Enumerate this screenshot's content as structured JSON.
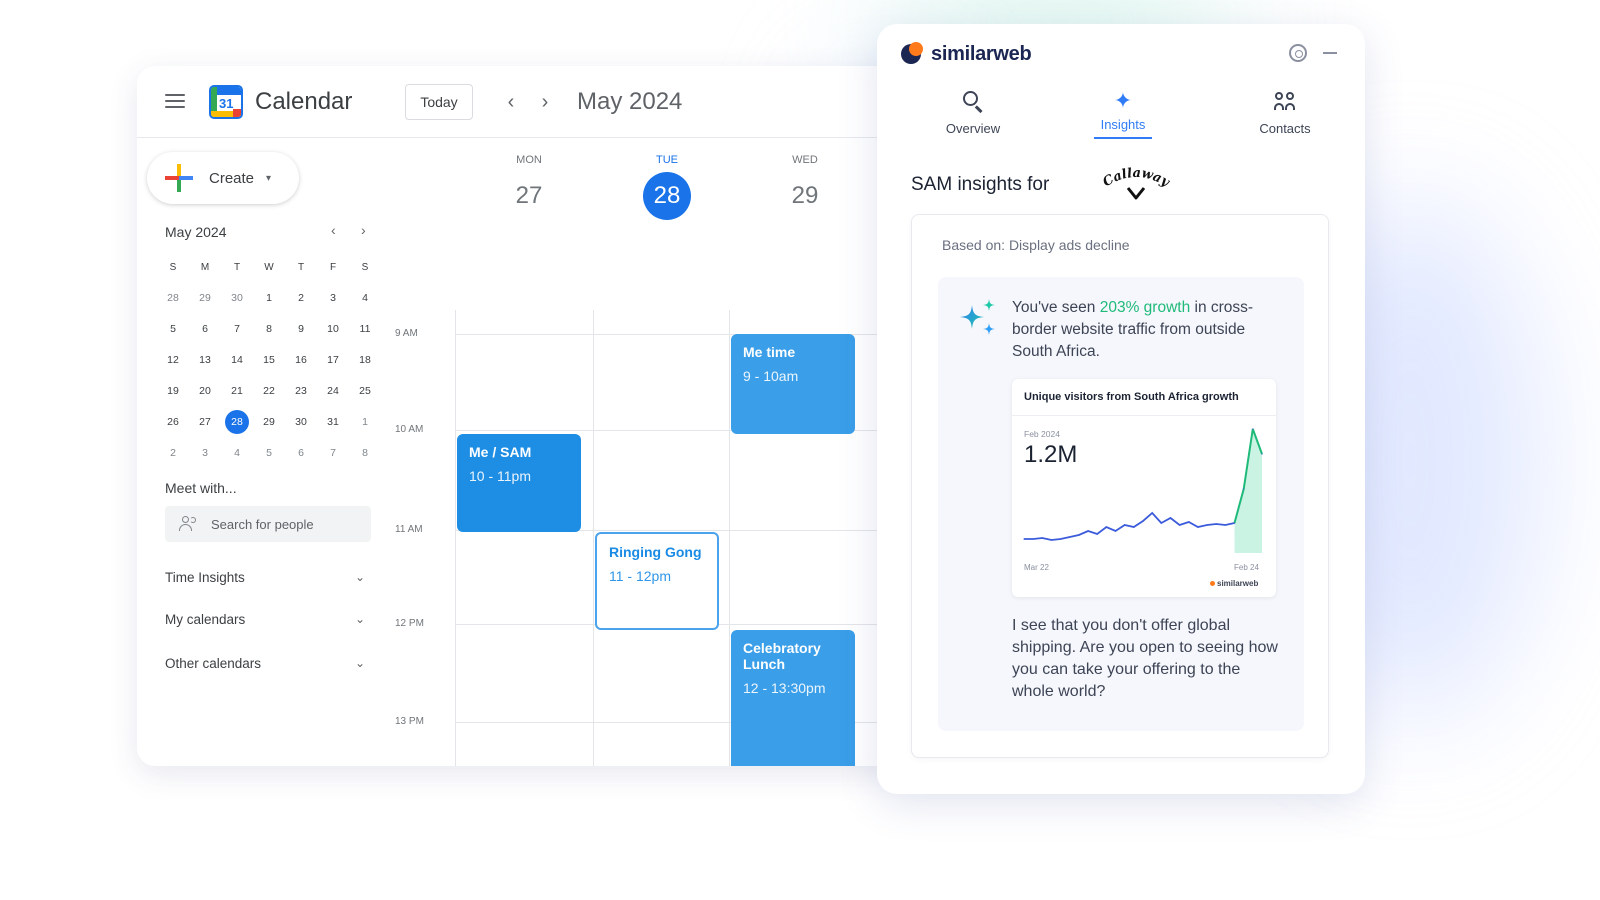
{
  "calendar": {
    "app_title": "Calendar",
    "logo_number": "31",
    "today_label": "Today",
    "prev_symbol": "‹",
    "next_symbol": "›",
    "month_label": "May 2024",
    "create_label": "Create",
    "create_caret": "▾",
    "mini": {
      "title": "May 2024",
      "prev_symbol": "‹",
      "next_symbol": "›",
      "weekdays": [
        "S",
        "M",
        "T",
        "W",
        "T",
        "F",
        "S"
      ],
      "weeks": [
        [
          "28",
          "29",
          "30",
          "1",
          "2",
          "3",
          "4"
        ],
        [
          "5",
          "6",
          "7",
          "8",
          "9",
          "10",
          "11"
        ],
        [
          "12",
          "13",
          "14",
          "15",
          "16",
          "17",
          "18"
        ],
        [
          "19",
          "20",
          "21",
          "22",
          "23",
          "24",
          "25"
        ],
        [
          "26",
          "27",
          "28",
          "29",
          "30",
          "31",
          "1"
        ],
        [
          "2",
          "3",
          "4",
          "5",
          "6",
          "7",
          "8"
        ]
      ],
      "selected": "28"
    },
    "meet_with_label": "Meet with...",
    "people_search_placeholder": "Search for people",
    "sections": [
      {
        "label": "Time Insights",
        "chevron": "⌄"
      },
      {
        "label": "My calendars",
        "chevron": "⌄"
      },
      {
        "label": "Other calendars",
        "chevron": "⌄"
      }
    ],
    "days": [
      {
        "dow": "MON",
        "num": "27",
        "today": false
      },
      {
        "dow": "TUE",
        "num": "28",
        "today": true
      },
      {
        "dow": "WED",
        "num": "29",
        "today": false
      }
    ],
    "hours": [
      "9 AM",
      "10 AM",
      "11 AM",
      "12 PM",
      "13 PM"
    ],
    "events": [
      {
        "title": "Me time",
        "time": "9 - 10am",
        "style": "solid"
      },
      {
        "title": "Me / SAM",
        "time": "10 - 11pm",
        "style": "solid-dark"
      },
      {
        "title": "Ringing Gong",
        "time": "11 - 12pm",
        "style": "outline"
      },
      {
        "title": "Celebratory Lunch",
        "time": "12 - 13:30pm",
        "style": "solid"
      }
    ]
  },
  "similarweb": {
    "brand": "similarweb",
    "tabs": [
      {
        "label": "Overview",
        "icon": "search-icon",
        "active": false
      },
      {
        "label": "Insights",
        "icon": "sparkle-icon",
        "active": true
      },
      {
        "label": "Contacts",
        "icon": "contacts-icon",
        "active": false
      }
    ],
    "sam_title": "SAM insights for",
    "company_logo_text": "Callaway",
    "based_on": "Based on: Display ads decline",
    "insight_pre": "You've seen ",
    "insight_highlight": "203% growth",
    "insight_post": " in cross-border website traffic from outside South Africa.",
    "colors": {
      "accent": "#2f7cf6",
      "highlight": "#1fba7a",
      "brand_dark": "#1b2653",
      "brand_orange": "#ff7a1a"
    },
    "chart": {
      "title": "Unique visitors from South Africa growth",
      "date_label": "Feb 2024",
      "value_label": "1.2M",
      "x_start": "Mar 22",
      "x_end": "Feb 24",
      "watermark": "similarweb"
    },
    "question": "I see that you don't offer global shipping. Are you open to seeing how you can take your offering to the whole world?"
  },
  "chart_data": {
    "type": "line",
    "title": "Unique visitors from South Africa growth",
    "series": [
      {
        "values": [
          0.1,
          0.1,
          0.11,
          0.09,
          0.1,
          0.12,
          0.14,
          0.18,
          0.15,
          0.22,
          0.18,
          0.24,
          0.22,
          0.28,
          0.36,
          0.26,
          0.31,
          0.24,
          0.27,
          0.22,
          0.24,
          0.25,
          0.24,
          0.26,
          0.6,
          1.2,
          0.95
        ]
      }
    ],
    "x_labels": [
      "Mar 22",
      "Feb 24"
    ],
    "highlight_label": "1.2M",
    "highlight_date": "Feb 2024",
    "grid": false
  }
}
